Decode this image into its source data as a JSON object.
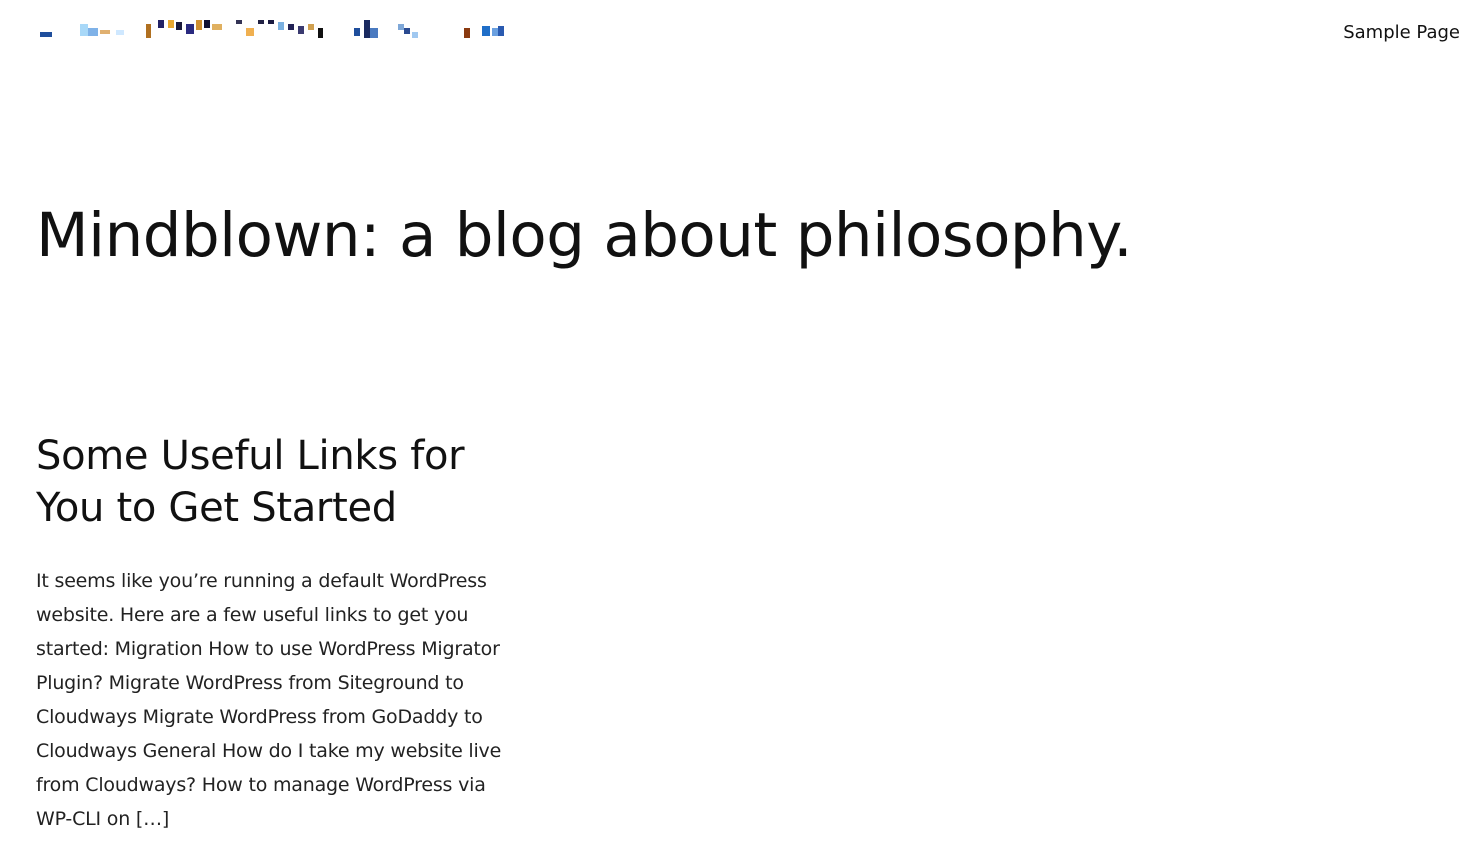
{
  "header": {
    "logo_alt": "site-logo",
    "nav": [
      {
        "label": "Sample Page"
      }
    ]
  },
  "hero": {
    "title": "Mindblown: a blog about philosophy."
  },
  "posts": [
    {
      "title": "Some Useful Links for You to Get Started",
      "excerpt": "It seems like you’re running a default WordPress website. Here are a few useful links to get you started: Migration How to use WordPress Migrator Plugin? Migrate WordPress from Siteground to Cloudways Migrate WordPress from GoDaddy to Cloudways General How do I take my website live from Cloudways? How to manage WordPress via WP-CLI on […]"
    }
  ]
}
